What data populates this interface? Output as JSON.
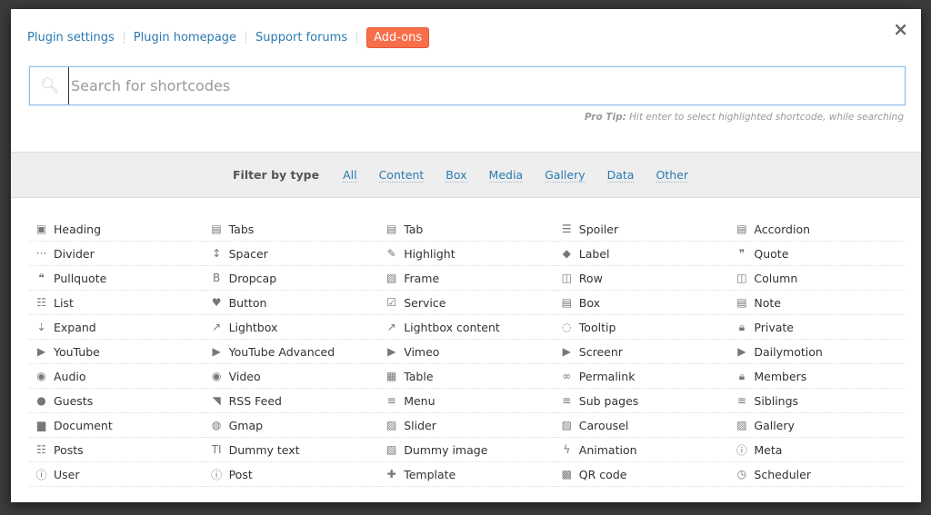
{
  "header": {
    "links": [
      "Plugin settings",
      "Plugin homepage",
      "Support forums"
    ],
    "addons": "Add-ons",
    "close": "×"
  },
  "search": {
    "placeholder": "Search for shortcodes",
    "value": "",
    "protip_label": "Pro Tip:",
    "protip_text": " Hit enter to select highlighted shortcode, while searching"
  },
  "filter": {
    "label": "Filter by type",
    "options": [
      "All",
      "Content",
      "Box",
      "Media",
      "Gallery",
      "Data",
      "Other"
    ]
  },
  "shortcodes": [
    {
      "label": "Heading",
      "icon": "heading-icon"
    },
    {
      "label": "Tabs",
      "icon": "list-alt-icon"
    },
    {
      "label": "Tab",
      "icon": "list-alt-icon"
    },
    {
      "label": "Spoiler",
      "icon": "list-icon"
    },
    {
      "label": "Accordion",
      "icon": "list-alt-icon"
    },
    {
      "label": "Divider",
      "icon": "ellipsis-icon"
    },
    {
      "label": "Spacer",
      "icon": "arrows-v-icon"
    },
    {
      "label": "Highlight",
      "icon": "pencil-icon"
    },
    {
      "label": "Label",
      "icon": "tag-icon"
    },
    {
      "label": "Quote",
      "icon": "quote-right-icon"
    },
    {
      "label": "Pullquote",
      "icon": "quote-left-icon"
    },
    {
      "label": "Dropcap",
      "icon": "bold-icon"
    },
    {
      "label": "Frame",
      "icon": "picture-icon"
    },
    {
      "label": "Row",
      "icon": "columns-icon"
    },
    {
      "label": "Column",
      "icon": "columns-icon"
    },
    {
      "label": "List",
      "icon": "list-ol-icon"
    },
    {
      "label": "Button",
      "icon": "heart-icon"
    },
    {
      "label": "Service",
      "icon": "check-square-icon"
    },
    {
      "label": "Box",
      "icon": "list-alt-icon"
    },
    {
      "label": "Note",
      "icon": "list-alt-icon"
    },
    {
      "label": "Expand",
      "icon": "sort-amount-icon"
    },
    {
      "label": "Lightbox",
      "icon": "external-link-icon"
    },
    {
      "label": "Lightbox content",
      "icon": "external-link-icon"
    },
    {
      "label": "Tooltip",
      "icon": "comment-icon"
    },
    {
      "label": "Private",
      "icon": "lock-icon"
    },
    {
      "label": "YouTube",
      "icon": "play-square-icon"
    },
    {
      "label": "YouTube Advanced",
      "icon": "play-square-icon"
    },
    {
      "label": "Vimeo",
      "icon": "play-square-icon"
    },
    {
      "label": "Screenr",
      "icon": "play-square-icon"
    },
    {
      "label": "Dailymotion",
      "icon": "play-square-icon"
    },
    {
      "label": "Audio",
      "icon": "play-circle-icon"
    },
    {
      "label": "Video",
      "icon": "play-circle-icon"
    },
    {
      "label": "Table",
      "icon": "table-icon"
    },
    {
      "label": "Permalink",
      "icon": "link-icon"
    },
    {
      "label": "Members",
      "icon": "lock-icon"
    },
    {
      "label": "Guests",
      "icon": "user-icon"
    },
    {
      "label": "RSS Feed",
      "icon": "rss-icon"
    },
    {
      "label": "Menu",
      "icon": "bars-icon"
    },
    {
      "label": "Sub pages",
      "icon": "bars-icon"
    },
    {
      "label": "Siblings",
      "icon": "bars-icon"
    },
    {
      "label": "Document",
      "icon": "file-text-icon"
    },
    {
      "label": "Gmap",
      "icon": "globe-icon"
    },
    {
      "label": "Slider",
      "icon": "picture-icon"
    },
    {
      "label": "Carousel",
      "icon": "picture-icon"
    },
    {
      "label": "Gallery",
      "icon": "picture-icon"
    },
    {
      "label": "Posts",
      "icon": "th-list-icon"
    },
    {
      "label": "Dummy text",
      "icon": "text-height-icon"
    },
    {
      "label": "Dummy image",
      "icon": "picture-icon"
    },
    {
      "label": "Animation",
      "icon": "bolt-icon"
    },
    {
      "label": "Meta",
      "icon": "info-circle-icon"
    },
    {
      "label": "User",
      "icon": "info-circle-icon"
    },
    {
      "label": "Post",
      "icon": "info-circle-icon"
    },
    {
      "label": "Template",
      "icon": "puzzle-icon"
    },
    {
      "label": "QR code",
      "icon": "qrcode-icon"
    },
    {
      "label": "Scheduler",
      "icon": "clock-icon"
    }
  ],
  "colors": {
    "link": "#2a7ab0",
    "addons": "#f86e4a",
    "filter_bg": "#eeeeee",
    "overlay": "#3b3b3b"
  }
}
